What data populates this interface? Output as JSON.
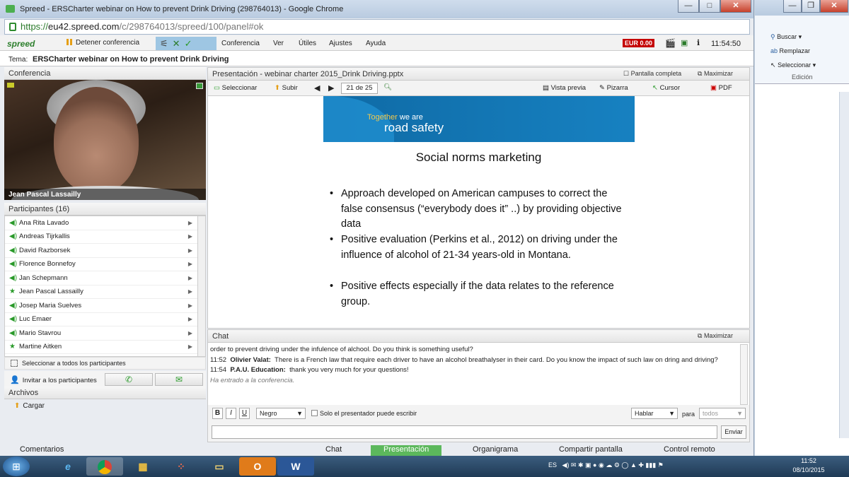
{
  "window": {
    "title": "Spreed - ERSCharter webinar on How to prevent Drink Driving (298764013) - Google Chrome",
    "min": "—",
    "max": "□",
    "close": "✕"
  },
  "browser": {
    "protocol": "https://",
    "host": "eu42.spreed.com",
    "path": "/c/298764013/spreed/100/panel#ok"
  },
  "app": {
    "logo": "spreed",
    "stop_label": "Detener conferencia",
    "menus": [
      "Conferencia",
      "Ver",
      "Útiles",
      "Ajustes",
      "Ayuda"
    ],
    "balance": "EUR 0.00",
    "time": "11:54:50"
  },
  "tema": {
    "label": "Tema:",
    "value": "ERSCharter webinar on How to prevent Drink Driving"
  },
  "conferencia": {
    "header": "Conferencia",
    "speaker": "Jean Pascal Lassailly"
  },
  "participants": {
    "header": "Participantes (16)",
    "items": [
      {
        "name": "Ana Rita Lavado",
        "icon": "speaker-icon"
      },
      {
        "name": "Andreas Tijrkallis",
        "icon": "speaker-icon"
      },
      {
        "name": "David Razborsek",
        "icon": "speaker-icon"
      },
      {
        "name": "Florence Bonnefoy",
        "icon": "speaker-icon"
      },
      {
        "name": "Jan Schepmann",
        "icon": "speaker-icon"
      },
      {
        "name": "Jean Pascal Lassailly",
        "icon": "star-icon"
      },
      {
        "name": "Josep Maria Suelves",
        "icon": "speaker-icon"
      },
      {
        "name": "Luc Emaer",
        "icon": "speaker-icon"
      },
      {
        "name": "Mario Stavrou",
        "icon": "speaker-icon"
      },
      {
        "name": "Martine Aitken",
        "icon": "star-icon"
      }
    ],
    "select_all": "Seleccionar a todos los participantes",
    "invite": "Invitar a los participantes"
  },
  "archivos": {
    "header": "Archivos",
    "upload": "Cargar"
  },
  "presentation": {
    "header": "Presentación - webinar charter 2015_Drink Driving.pptx",
    "fullscreen": "Pantalla completa",
    "maximize": "Maximizar",
    "tools": {
      "select": "Seleccionar",
      "upload": "Subir",
      "page": "21 de 25",
      "preview": "Vista previa",
      "whiteboard": "Pizarra",
      "cursor": "Cursor",
      "pdf": "PDF"
    },
    "slide": {
      "banner_small_a": "Together",
      "banner_small_b": " we are",
      "banner_big": "road safety",
      "title": "Social norms marketing",
      "bullets": [
        "Approach developed on American campuses to correct the false consensus (“everybody does it” ..) by providing objective data",
        "Positive evaluation (Perkins et al., 2012) on driving under the influence of alcohol of 21-34 years-old in Montana.",
        "Positive effects especially if the data relates to the reference group."
      ]
    }
  },
  "chat": {
    "header": "Chat",
    "maximize": "Maximizar",
    "messages": [
      {
        "time": "",
        "author": "",
        "text": "order to prevent driving under the infulence of alchool. Do you think is something useful?"
      },
      {
        "time": "11:52",
        "author": "Olivier Valat:",
        "text": "There is a French law that require each driver to have an alcohol breathalyser in their card. Do you know the impact of such law on dring and driving?"
      },
      {
        "time": "11:54",
        "author": "P.A.U. Education:",
        "text": "thank you very much for your questions!"
      }
    ],
    "system": "Ha entrado a la conferencia.",
    "bold": "B",
    "italic": "I",
    "underline": "U",
    "font": "Negro",
    "presenter_only": "Solo el presentador puede escribir",
    "mode": "Hablar",
    "to_label": "para",
    "to": "todos",
    "send": "Enviar"
  },
  "bottom_tabs": [
    "Comentarios",
    "Chat",
    "Presentación",
    "Organigrama",
    "Compartir pantalla",
    "Control remoto"
  ],
  "word": {
    "find": "Buscar",
    "replace": "Remplazar",
    "select": "Seleccionar",
    "group": "Edición"
  },
  "taskbar": {
    "lang": "ES",
    "time": "11:52",
    "date": "08/10/2015"
  }
}
